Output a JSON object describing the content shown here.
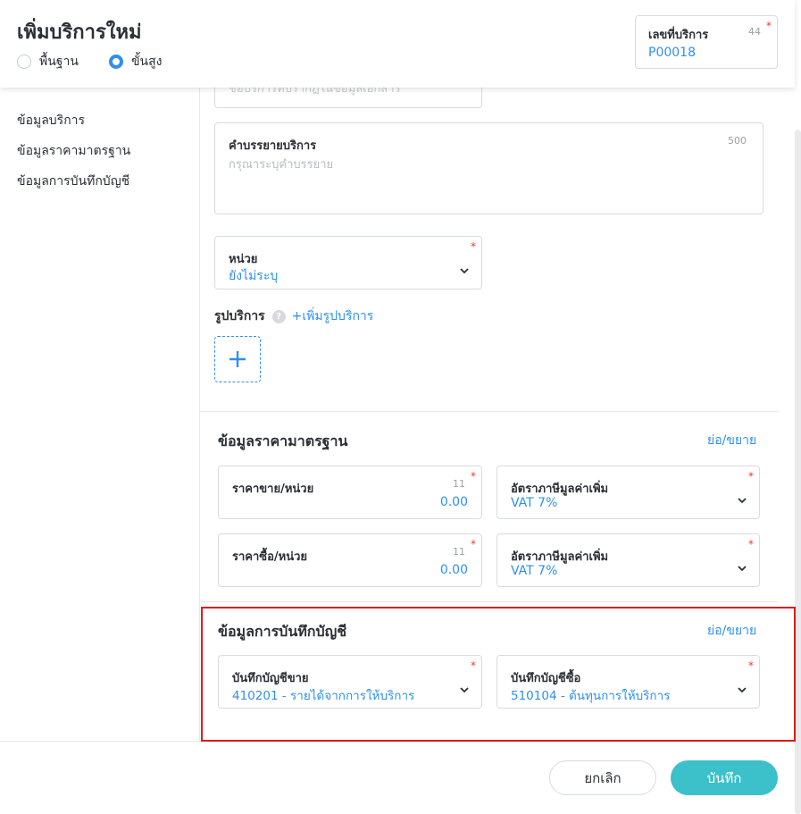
{
  "header": {
    "title": "เพิ่มบริการใหม่",
    "mode_options": [
      {
        "label": "พื้นฐาน",
        "selected": false
      },
      {
        "label": "ขั้นสูง",
        "selected": true
      }
    ],
    "service_number": {
      "label": "เลขที่บริการ",
      "counter": "44",
      "value": "P00018",
      "required": "*"
    }
  },
  "sidebar": {
    "items": [
      {
        "label": "ข้อมูลบริการ"
      },
      {
        "label": "ข้อมูลราคามาตรฐาน"
      },
      {
        "label": "ข้อมูลการบันทึกบัญชี"
      }
    ]
  },
  "service_info": {
    "name_placeholder": "ชื่อบริการที่ปรากฏในข้อมูลเอกสาร",
    "description": {
      "label": "คำบรรยายบริการ",
      "counter": "500",
      "placeholder": "กรุณาระบุคำบรรยาย"
    },
    "unit": {
      "label": "หน่วย",
      "value": "ยังไม่ระบุ",
      "required": "*"
    },
    "image": {
      "label": "รูปบริการ",
      "help": "?",
      "add_link": "+เพิ่มรูปบริการ"
    }
  },
  "pricing": {
    "title": "ข้อมูลราคามาตรฐาน",
    "toggle": "ย่อ/ขยาย",
    "sale_price": {
      "label": "ราคาขาย/หน่วย",
      "counter": "11",
      "value": "0.00",
      "required": "*"
    },
    "sale_vat": {
      "label": "อัตราภาษีมูลค่าเพิ่ม",
      "value": "VAT 7%",
      "required": "*"
    },
    "buy_price": {
      "label": "ราคาซื้อ/หน่วย",
      "counter": "11",
      "value": "0.00",
      "required": "*"
    },
    "buy_vat": {
      "label": "อัตราภาษีมูลค่าเพิ่ม",
      "value": "VAT 7%",
      "required": "*"
    }
  },
  "accounting": {
    "title": "ข้อมูลการบันทึกบัญชี",
    "toggle": "ย่อ/ขยาย",
    "sales_account": {
      "label": "บันทึกบัญชีขาย",
      "value": "410201 - รายได้จากการให้บริการ",
      "required": "*"
    },
    "purchase_account": {
      "label": "บันทึกบัญชีซื้อ",
      "value": "510104 - ต้นทุนการให้บริการ",
      "required": "*"
    }
  },
  "footer": {
    "cancel_label": "ยกเลิก",
    "save_label": "บันทึก"
  },
  "colors": {
    "accent": "#2f8ff0",
    "save": "#3cc0c9",
    "highlight": "#e01818",
    "required": "#e53935"
  }
}
